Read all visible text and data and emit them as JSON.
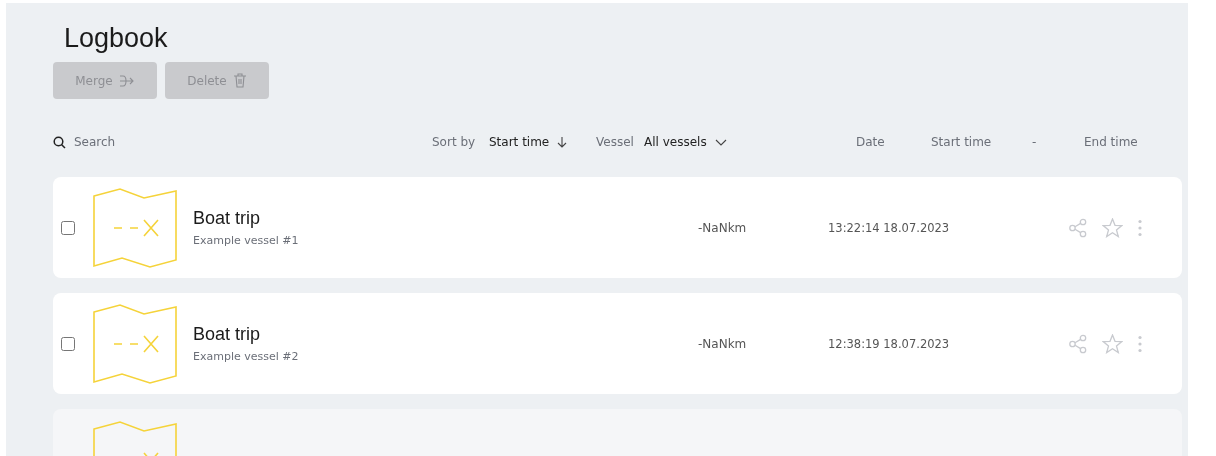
{
  "page": {
    "title": "Logbook"
  },
  "toolbar": {
    "buttons": [
      {
        "kind": "merge",
        "label": "Merge",
        "disabled": true
      },
      {
        "kind": "delete",
        "label": "Delete",
        "disabled": true
      }
    ]
  },
  "filters": {
    "search_placeholder": "Search",
    "sort_label": "Sort by",
    "sort_value": "Start time",
    "vessel_label": "Vessel",
    "vessel_value": "All vessels"
  },
  "columns": [
    "Date",
    "Start time",
    "-",
    "End time"
  ],
  "rows": [
    {
      "kind": "trip",
      "title": "Boat trip",
      "vessel": "Example vessel #1",
      "distance": "-NaNkm",
      "start": "13:22:14 18.07.2023",
      "checked": false,
      "favorite": false
    },
    {
      "kind": "trip",
      "title": "Boat trip",
      "vessel": "Example vessel #2",
      "distance": "-NaNkm",
      "start": "12:38:19 18.07.2023",
      "checked": false,
      "favorite": false
    },
    {
      "kind": "loading"
    }
  ]
}
